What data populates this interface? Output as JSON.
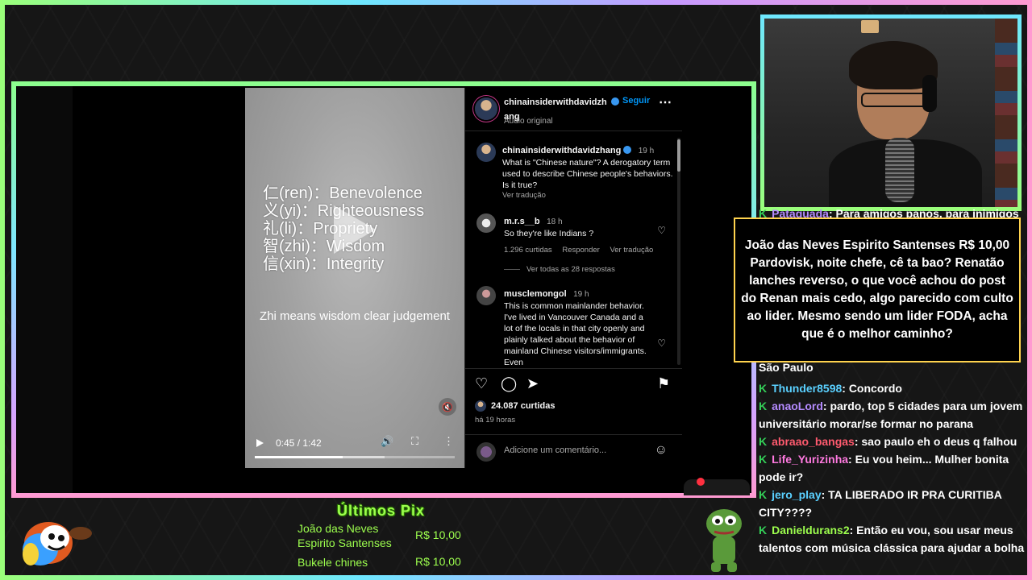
{
  "video": {
    "virtues": [
      "仁(ren)：Benevolence",
      "义(yi)：Righteousness",
      "礼(li)：Propriety",
      "智(zhi)：Wisdom",
      "信(xin)：Integrity"
    ],
    "caption": "Zhi means wisdom clear judgement",
    "time": "0:45 / 1:42",
    "progress_fraction": 0.44,
    "buffered_fraction": 0.65
  },
  "post": {
    "author": "chinainsiderwithdavidzh ang",
    "follow_label": "Seguir",
    "audio": "Áudio original",
    "more_icon": "more-horizontal-icon",
    "caption_author": "chinainsiderwithdavidzhang",
    "caption_time": "19 h",
    "caption_text": "What is \"Chinese nature\"? A derogatory term used to describe Chinese people's behaviors. Is it true?",
    "translate": "Ver tradução",
    "likes": "24.087 curtidas",
    "posted": "há 19 horas",
    "add_comment_placeholder": "Adicione um comentário..."
  },
  "comments": [
    {
      "user": "m.r.s__b",
      "time": "18 h",
      "text": "So they're like Indians ?",
      "likes": "1.296 curtidas",
      "reply": "Responder",
      "translate": "Ver tradução",
      "view_replies": "Ver todas as 28 respostas"
    },
    {
      "user": "musclemongol",
      "time": "19 h",
      "text": "This is common mainlander behavior. I've lived in Vancouver Canada and a lot of the locals in that city openly and plainly talked about the behavior of mainland Chinese visitors/immigrants. Even"
    }
  ],
  "alert": {
    "text": "João das Neves Espirito Santenses R$ 10,00 Pardovisk, noite chefe, cê ta bao? Renatão lanches reverso, o que você achou do post do Renan mais cedo, algo parecido com culto ao lider. Mesmo sendo um lider FODA, acha que é o melhor caminho?"
  },
  "chat": {
    "partial_top_user": "Pataquada",
    "partial_top_text": ": Para amigos panos, para inimigos",
    "partial_line": "São Paulo",
    "messages": [
      {
        "user": "Thunder8598",
        "color": "#5ad0ff",
        "text": ": Concordo"
      },
      {
        "user": "anaoLord",
        "color": "#b58bff",
        "text": ": pardo, top 5 cidades para um jovem universitário morar/se formar no parana"
      },
      {
        "user": "abraao_bangas",
        "color": "#ff5a6e",
        "text": ": sao paulo eh o deus q falhou"
      },
      {
        "user": "Life_Yurizinha",
        "color": "#ff7ae0",
        "text": ": Eu vou heim... Mulher bonita pode ir?"
      },
      {
        "user": "jero_play",
        "color": "#5ad0ff",
        "text": ": TA LIBERADO IR PRA CURITIBA CITY????"
      },
      {
        "user": "Danieldurans2",
        "color": "#9dff4e",
        "text": ": Então eu vou, sou usar meus talentos com música clássica para ajudar a bolha"
      }
    ]
  },
  "pix": {
    "title": "Últimos Pix",
    "entries": [
      {
        "name": "João das Neves Espirito Santenses",
        "value": "R$ 10,00"
      },
      {
        "name": "Bukele chines",
        "value": "R$ 10,00"
      }
    ]
  }
}
